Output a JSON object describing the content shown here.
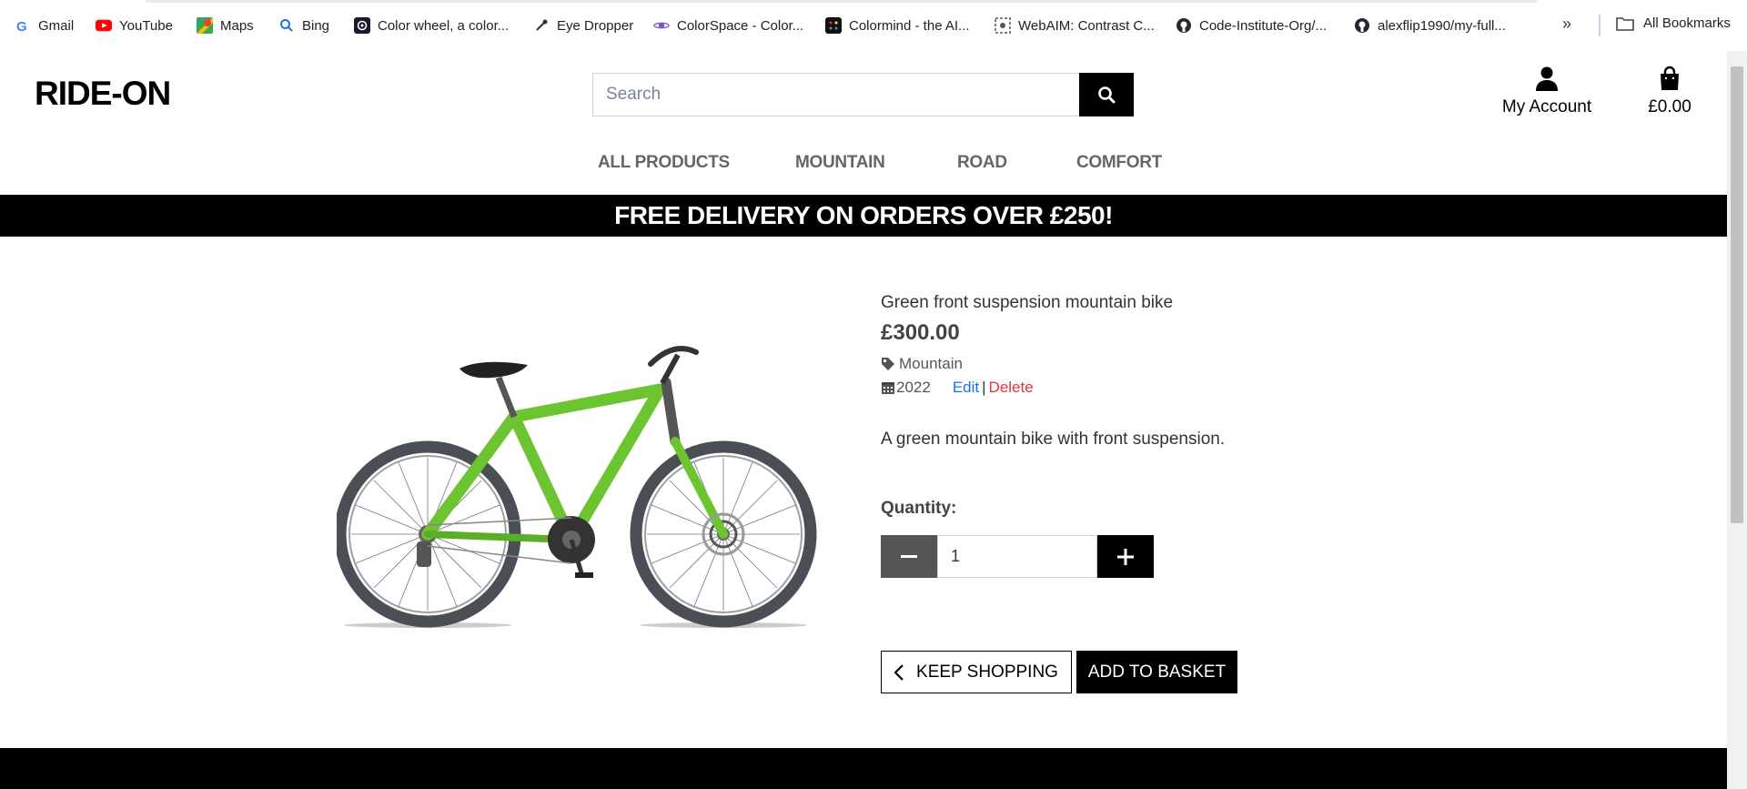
{
  "bookmarks": [
    {
      "label": "Gmail",
      "icon": "google-icon"
    },
    {
      "label": "YouTube",
      "icon": "youtube-icon"
    },
    {
      "label": "Maps",
      "icon": "maps-icon"
    },
    {
      "label": "Bing",
      "icon": "bing-search-icon"
    },
    {
      "label": "Color wheel, a color...",
      "icon": "color-wheel-icon"
    },
    {
      "label": "Eye Dropper",
      "icon": "eyedropper-icon"
    },
    {
      "label": "ColorSpace - Color...",
      "icon": "colorspace-icon"
    },
    {
      "label": "Colormind - the AI...",
      "icon": "colormind-icon"
    },
    {
      "label": "WebAIM: Contrast C...",
      "icon": "webaim-icon"
    },
    {
      "label": "Code-Institute-Org/...",
      "icon": "github-icon"
    },
    {
      "label": "alexflip1990/my-full...",
      "icon": "github-icon"
    }
  ],
  "bookmarks_more": "»",
  "all_bookmarks": "All Bookmarks",
  "header": {
    "logo": "RIDE-ON",
    "search_placeholder": "Search",
    "account_label": "My Account",
    "basket_total": "£0.00"
  },
  "nav": [
    "ALL PRODUCTS",
    "MOUNTAIN",
    "ROAD",
    "COMFORT"
  ],
  "banner": "FREE DELIVERY ON ORDERS OVER £250!",
  "product": {
    "name": "Green front suspension mountain bike",
    "price": "£300.00",
    "category": "Mountain",
    "year": "2022",
    "edit_label": "Edit",
    "separator": "|",
    "delete_label": "Delete",
    "description": "A green mountain bike with front suspension.",
    "quantity_label": "Quantity:",
    "quantity_value": "1"
  },
  "buttons": {
    "keep_shopping": "KEEP SHOPPING",
    "add_to_basket": "ADD TO BASKET"
  },
  "colors": {
    "brand_black": "#000000",
    "bike_green": "#6cc430",
    "edit_blue": "#1a73e8",
    "delete_red": "#dc3545"
  }
}
